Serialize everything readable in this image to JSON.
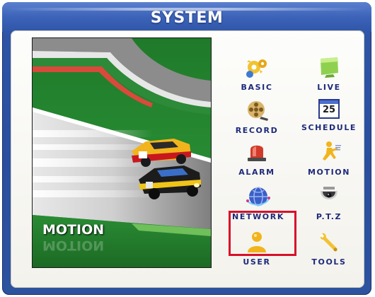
{
  "window": {
    "title": "SYSTEM"
  },
  "preview": {
    "label": "MOTION",
    "image": "race-cars-on-track"
  },
  "menu": {
    "selected": "NETWORK",
    "items": [
      {
        "label": "BASIC",
        "icon": "gears-icon"
      },
      {
        "label": "LIVE",
        "icon": "monitor-icon"
      },
      {
        "label": "RECORD",
        "icon": "film-reel-icon"
      },
      {
        "label": "SCHEDULE",
        "icon": "calendar-icon",
        "calendar_day": "25"
      },
      {
        "label": "ALARM",
        "icon": "siren-icon"
      },
      {
        "label": "MOTION",
        "icon": "running-person-icon"
      },
      {
        "label": "NETWORK",
        "icon": "globe-icon"
      },
      {
        "label": "P.T.Z",
        "icon": "dome-camera-icon"
      },
      {
        "label": "USER",
        "icon": "user-icon"
      },
      {
        "label": "TOOLS",
        "icon": "wrench-icon"
      }
    ]
  },
  "colors": {
    "selection_border": "#d8102a",
    "label_text": "#1e2a7a",
    "frame_blue": "#2e54a6"
  }
}
